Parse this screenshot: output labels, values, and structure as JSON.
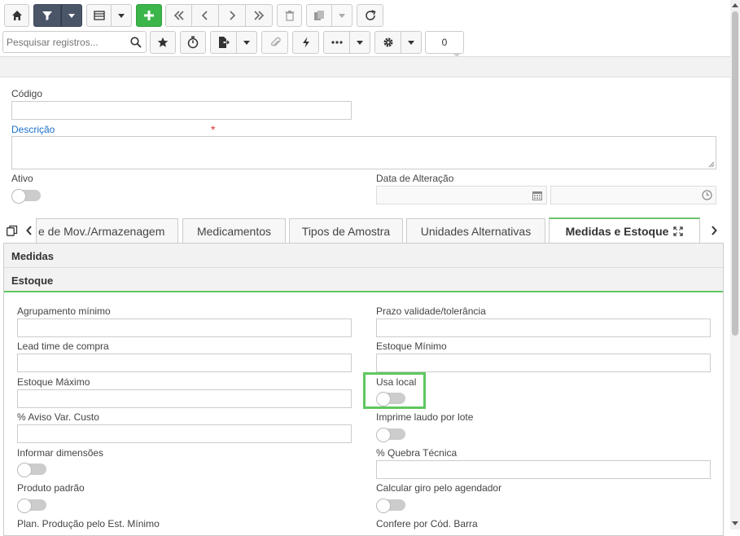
{
  "toolbar": {
    "search_placeholder": "Pesquisar registros...",
    "record_count": "0"
  },
  "form": {
    "codigo_label": "Código",
    "descricao_label": "Descrição",
    "required_mark": "*",
    "ativo_label": "Ativo",
    "data_alteracao_label": "Data de Alteração"
  },
  "tabs": [
    {
      "label": "e de Mov./Armazenagem"
    },
    {
      "label": "Medicamentos"
    },
    {
      "label": "Tipos de Amostra"
    },
    {
      "label": "Unidades Alternativas"
    },
    {
      "label": "Medidas e Estoque"
    }
  ],
  "sections": {
    "medidas": "Medidas",
    "estoque": "Estoque"
  },
  "estoque_fields": {
    "agrupamento_minimo": "Agrupamento mínimo",
    "prazo_validade": "Prazo validade/tolerância",
    "lead_time": "Lead time de compra",
    "estoque_minimo": "Estoque Mínimo",
    "estoque_maximo": "Estoque Máximo",
    "usa_local": "Usa local",
    "aviso_var_custo": "% Aviso Var. Custo",
    "imprime_laudo": "Imprime laudo por lote",
    "informar_dimensoes": "Informar dimensões",
    "quebra_tecnica": "% Quebra Técnica",
    "produto_padrao": "Produto padrão",
    "calcular_giro": "Calcular giro pelo agendador",
    "plan_producao": "Plan. Produção pelo Est. Mínimo",
    "confere_cod_barra": "Confere por Cód. Barra"
  },
  "colors": {
    "accent_green": "#3cb54a",
    "highlight_green": "#5ec85e",
    "link_blue": "#1a6fc9",
    "required_red": "#d9302c"
  }
}
